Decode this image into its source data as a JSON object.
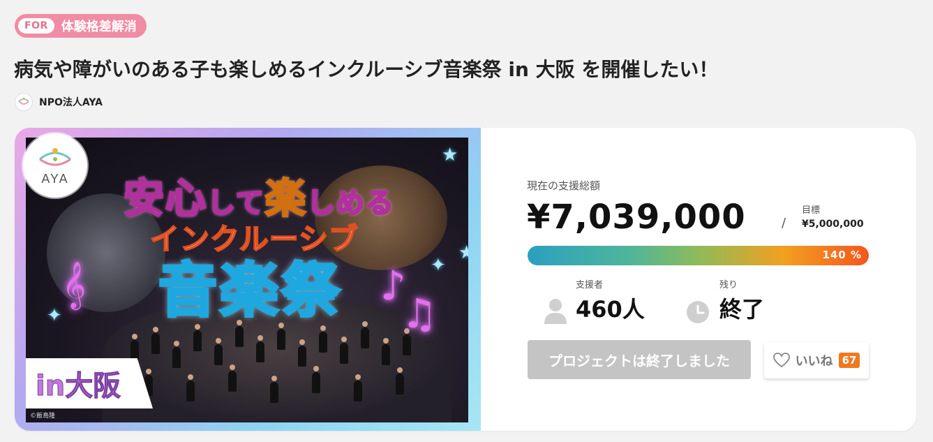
{
  "tag": {
    "prefix": "FOR",
    "label": "体験格差解消",
    "color": "#f08ca3"
  },
  "project": {
    "title": "病気や障がいのある子も楽しめるインクルーシブ音楽祭 in 大阪 を開催したい！",
    "organization": "NPO法人AYA"
  },
  "visual": {
    "logo_text": "AYA",
    "headline_part1a": "安心",
    "headline_part1b": "して",
    "headline_part1c": "楽",
    "headline_part1d": "しめる",
    "headline_line2": "インクルーシブ",
    "headline_line3": "音楽祭",
    "city_badge": "in大阪",
    "copyright": "©飯島隆"
  },
  "funding": {
    "raised_label": "現在の支援総額",
    "raised_amount": "¥7,039,000",
    "separator": "/",
    "goal_label": "目標",
    "goal_amount": "¥5,000,000",
    "progress_text": "140 %",
    "progress_percent": 140
  },
  "stats": {
    "supporters_label": "支援者",
    "supporters_value": "460人",
    "remaining_label": "残り",
    "remaining_value": "終了"
  },
  "actions": {
    "ended_button": "プロジェクトは終了しました",
    "like_label": "いいね",
    "like_count": "67"
  },
  "icons": {
    "org": "aya-logo-icon",
    "person": "person-icon",
    "clock": "clock-icon",
    "heart": "heart-icon"
  },
  "colors": {
    "accent_pink": "#f08ca3",
    "like_badge": "#f2781f",
    "progress_start": "#2aa0c0",
    "progress_end": "#f4561e"
  }
}
